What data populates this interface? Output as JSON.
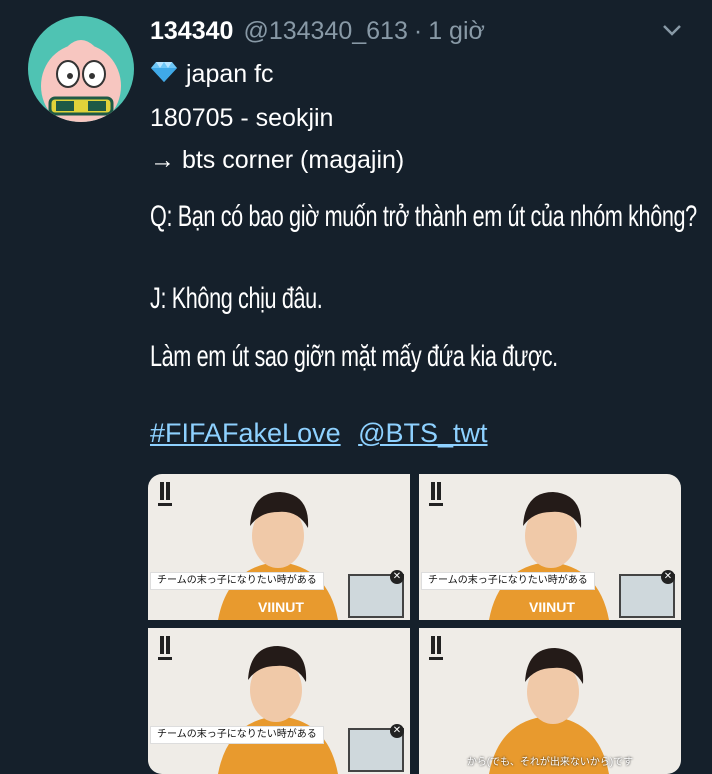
{
  "tweet": {
    "display_name": "134340",
    "handle": "@134340_613",
    "separator": "·",
    "time": "1 giờ",
    "lines": [
      "japan fc",
      "180705 - seokjin",
      "→ bts corner (magajin)"
    ],
    "quote_lines": [
      "Q: Bạn có bao giờ muốn trở thành em út của nhóm không?",
      "J: Không chịu đâu.",
      "Làm em út sao giỡn mặt mấy đứa kia được."
    ],
    "hashtag": "#FIFAFakeLove",
    "mention": "@BTS_twt"
  },
  "media": {
    "subtitle_jp": "チームの末っ子になりたい時がある",
    "bottom_caption": "から(でも、それが出来ないから)です",
    "shirt_text": "VIINUT"
  },
  "icons": {
    "avatar": "peach-character-avatar",
    "badge": "blue-diamond-icon",
    "menu": "chevron-down-icon"
  },
  "colors": {
    "background": "#15202b",
    "link": "#8ed1ff",
    "muted": "#8899a6"
  }
}
